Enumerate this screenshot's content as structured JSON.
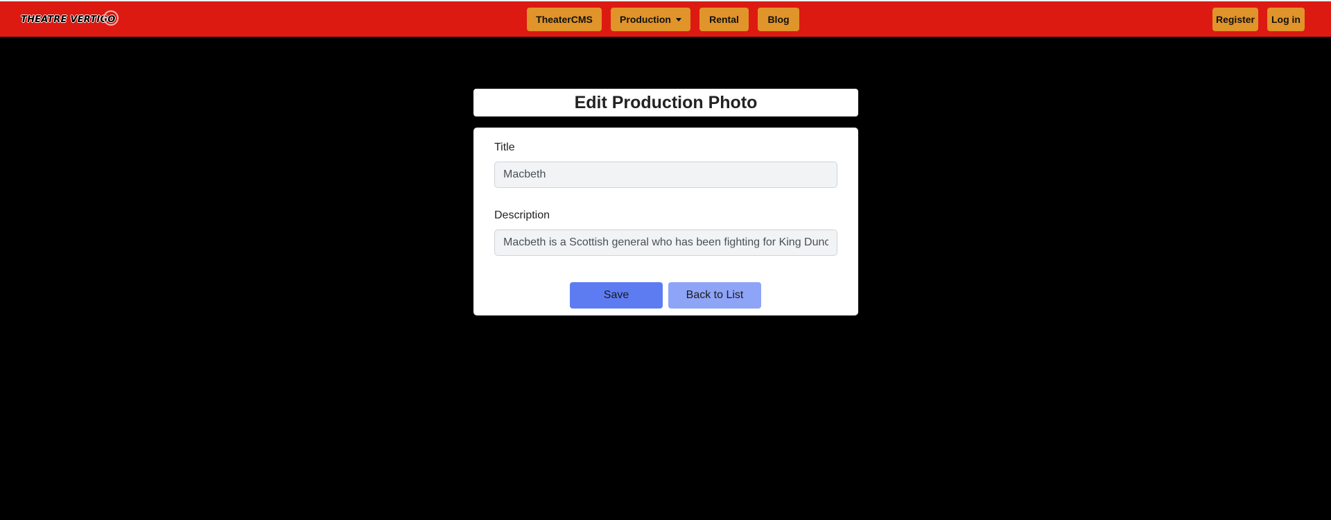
{
  "navbar": {
    "logo_text": "THEATRE VERTIGO",
    "items": [
      {
        "label": "TheaterCMS"
      },
      {
        "label": "Production"
      },
      {
        "label": "Rental"
      },
      {
        "label": "Blog"
      }
    ],
    "register_label": "Register",
    "login_label": "Log in",
    "colors": {
      "bar": "#dc1a12",
      "button": "#e0942a"
    }
  },
  "page": {
    "title": "Edit Production Photo"
  },
  "form": {
    "title_label": "Title",
    "title_value": "Macbeth",
    "description_label": "Description",
    "description_value": "Macbeth is a Scottish general who has been fighting for King Duncan",
    "save_label": "Save",
    "back_label": "Back to List",
    "colors": {
      "save": "#5e7cf1",
      "back": "#8ea4f7"
    }
  }
}
